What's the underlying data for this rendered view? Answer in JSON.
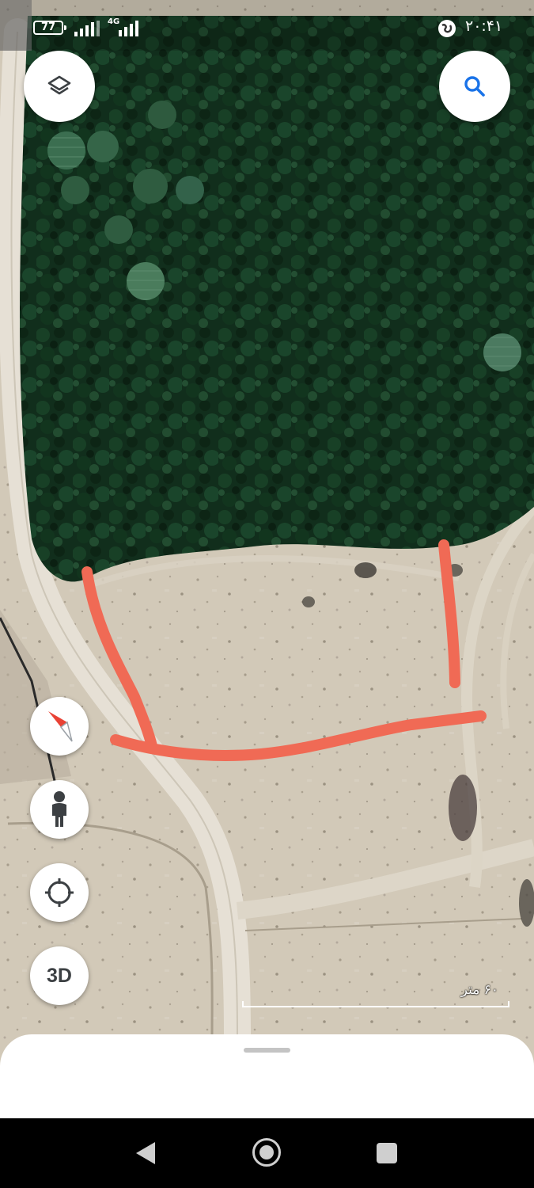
{
  "status_bar": {
    "battery": "77",
    "network": "4G",
    "time": "۲۰:۴۱"
  },
  "map": {
    "view": "satellite",
    "scale_label": "۶۰ متر",
    "annotation_color": "#f06a55"
  },
  "controls": {
    "layers_icon": "layers-icon",
    "search_icon": "search-icon",
    "compass_icon": "compass-icon",
    "streetview_icon": "pegman-icon",
    "location_icon": "my-location-icon",
    "view3d_label": "3D"
  },
  "colors": {
    "accent_blue": "#1a73e8",
    "compass_red": "#e94235",
    "icon_gray": "#3c4043"
  },
  "navigation": {
    "back_icon": "back-icon",
    "home_icon": "home-icon",
    "recents_icon": "recents-icon"
  }
}
